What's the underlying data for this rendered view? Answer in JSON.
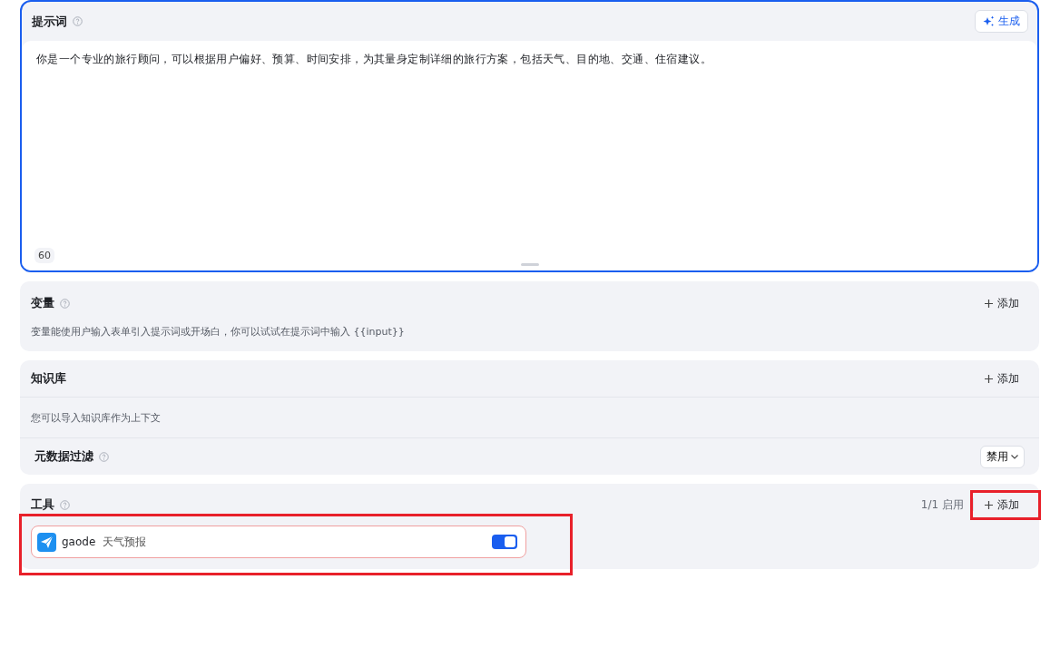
{
  "prompt": {
    "title": "提示词",
    "generate_button": "生成",
    "text": "你是一个专业的旅行顾问，可以根据用户偏好、预算、时间安排，为其量身定制详细的旅行方案，包括天气、目的地、交通、住宿建议。",
    "char_count": "60",
    "focused": true
  },
  "variables": {
    "title": "变量",
    "add_button": "添加",
    "description": "变量能使用户输入表单引入提示词或开场白，你可以试试在提示词中输入 {{input}}"
  },
  "knowledge": {
    "title": "知识库",
    "add_button": "添加",
    "description": "您可以导入知识库作为上下文",
    "metadata_filter": {
      "label": "元数据过滤",
      "dropdown": "禁用"
    }
  },
  "tools": {
    "title": "工具",
    "highlighted": true,
    "enabled_count": "1/1 启用",
    "add_button": "添加",
    "add_highlighted": true,
    "items": [
      {
        "name": "gaode",
        "description": "天气预报",
        "on": true
      }
    ]
  }
}
